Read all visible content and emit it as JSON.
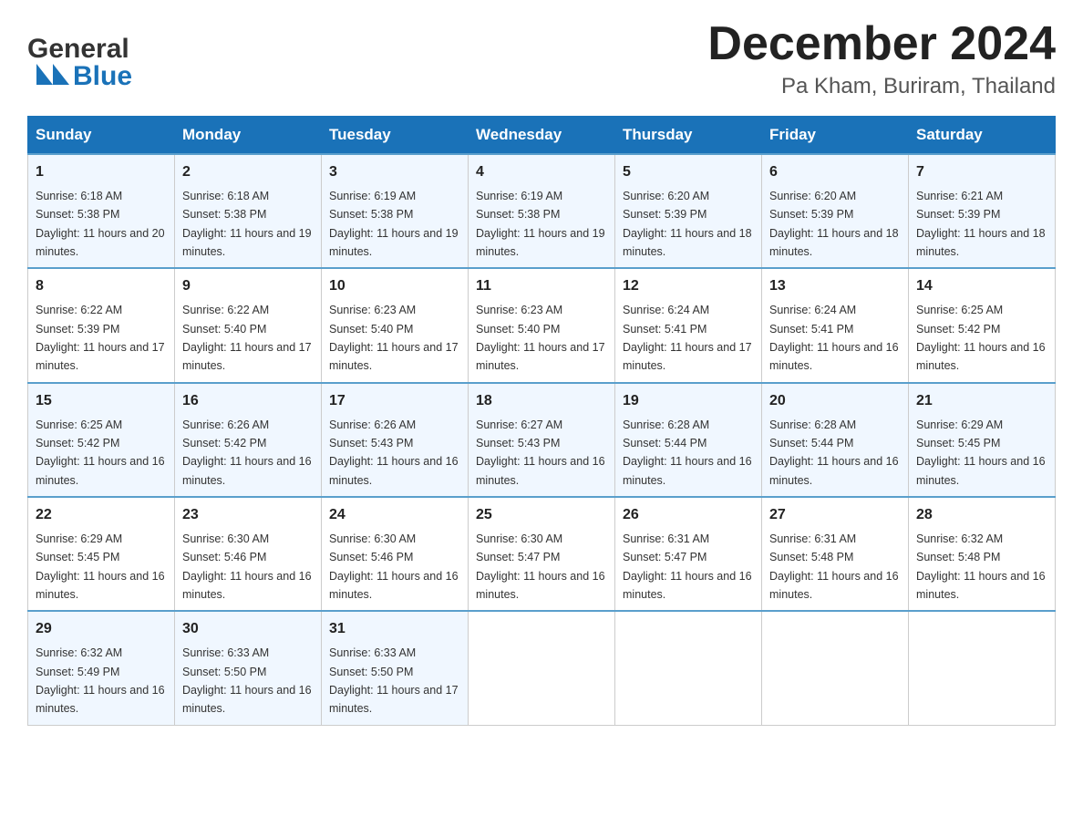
{
  "header": {
    "logo_general": "General",
    "logo_blue": "Blue",
    "title": "December 2024",
    "subtitle": "Pa Kham, Buriram, Thailand"
  },
  "days_of_week": [
    "Sunday",
    "Monday",
    "Tuesday",
    "Wednesday",
    "Thursday",
    "Friday",
    "Saturday"
  ],
  "weeks": [
    [
      {
        "day": "1",
        "sunrise": "Sunrise: 6:18 AM",
        "sunset": "Sunset: 5:38 PM",
        "daylight": "Daylight: 11 hours and 20 minutes."
      },
      {
        "day": "2",
        "sunrise": "Sunrise: 6:18 AM",
        "sunset": "Sunset: 5:38 PM",
        "daylight": "Daylight: 11 hours and 19 minutes."
      },
      {
        "day": "3",
        "sunrise": "Sunrise: 6:19 AM",
        "sunset": "Sunset: 5:38 PM",
        "daylight": "Daylight: 11 hours and 19 minutes."
      },
      {
        "day": "4",
        "sunrise": "Sunrise: 6:19 AM",
        "sunset": "Sunset: 5:38 PM",
        "daylight": "Daylight: 11 hours and 19 minutes."
      },
      {
        "day": "5",
        "sunrise": "Sunrise: 6:20 AM",
        "sunset": "Sunset: 5:39 PM",
        "daylight": "Daylight: 11 hours and 18 minutes."
      },
      {
        "day": "6",
        "sunrise": "Sunrise: 6:20 AM",
        "sunset": "Sunset: 5:39 PM",
        "daylight": "Daylight: 11 hours and 18 minutes."
      },
      {
        "day": "7",
        "sunrise": "Sunrise: 6:21 AM",
        "sunset": "Sunset: 5:39 PM",
        "daylight": "Daylight: 11 hours and 18 minutes."
      }
    ],
    [
      {
        "day": "8",
        "sunrise": "Sunrise: 6:22 AM",
        "sunset": "Sunset: 5:39 PM",
        "daylight": "Daylight: 11 hours and 17 minutes."
      },
      {
        "day": "9",
        "sunrise": "Sunrise: 6:22 AM",
        "sunset": "Sunset: 5:40 PM",
        "daylight": "Daylight: 11 hours and 17 minutes."
      },
      {
        "day": "10",
        "sunrise": "Sunrise: 6:23 AM",
        "sunset": "Sunset: 5:40 PM",
        "daylight": "Daylight: 11 hours and 17 minutes."
      },
      {
        "day": "11",
        "sunrise": "Sunrise: 6:23 AM",
        "sunset": "Sunset: 5:40 PM",
        "daylight": "Daylight: 11 hours and 17 minutes."
      },
      {
        "day": "12",
        "sunrise": "Sunrise: 6:24 AM",
        "sunset": "Sunset: 5:41 PM",
        "daylight": "Daylight: 11 hours and 17 minutes."
      },
      {
        "day": "13",
        "sunrise": "Sunrise: 6:24 AM",
        "sunset": "Sunset: 5:41 PM",
        "daylight": "Daylight: 11 hours and 16 minutes."
      },
      {
        "day": "14",
        "sunrise": "Sunrise: 6:25 AM",
        "sunset": "Sunset: 5:42 PM",
        "daylight": "Daylight: 11 hours and 16 minutes."
      }
    ],
    [
      {
        "day": "15",
        "sunrise": "Sunrise: 6:25 AM",
        "sunset": "Sunset: 5:42 PM",
        "daylight": "Daylight: 11 hours and 16 minutes."
      },
      {
        "day": "16",
        "sunrise": "Sunrise: 6:26 AM",
        "sunset": "Sunset: 5:42 PM",
        "daylight": "Daylight: 11 hours and 16 minutes."
      },
      {
        "day": "17",
        "sunrise": "Sunrise: 6:26 AM",
        "sunset": "Sunset: 5:43 PM",
        "daylight": "Daylight: 11 hours and 16 minutes."
      },
      {
        "day": "18",
        "sunrise": "Sunrise: 6:27 AM",
        "sunset": "Sunset: 5:43 PM",
        "daylight": "Daylight: 11 hours and 16 minutes."
      },
      {
        "day": "19",
        "sunrise": "Sunrise: 6:28 AM",
        "sunset": "Sunset: 5:44 PM",
        "daylight": "Daylight: 11 hours and 16 minutes."
      },
      {
        "day": "20",
        "sunrise": "Sunrise: 6:28 AM",
        "sunset": "Sunset: 5:44 PM",
        "daylight": "Daylight: 11 hours and 16 minutes."
      },
      {
        "day": "21",
        "sunrise": "Sunrise: 6:29 AM",
        "sunset": "Sunset: 5:45 PM",
        "daylight": "Daylight: 11 hours and 16 minutes."
      }
    ],
    [
      {
        "day": "22",
        "sunrise": "Sunrise: 6:29 AM",
        "sunset": "Sunset: 5:45 PM",
        "daylight": "Daylight: 11 hours and 16 minutes."
      },
      {
        "day": "23",
        "sunrise": "Sunrise: 6:30 AM",
        "sunset": "Sunset: 5:46 PM",
        "daylight": "Daylight: 11 hours and 16 minutes."
      },
      {
        "day": "24",
        "sunrise": "Sunrise: 6:30 AM",
        "sunset": "Sunset: 5:46 PM",
        "daylight": "Daylight: 11 hours and 16 minutes."
      },
      {
        "day": "25",
        "sunrise": "Sunrise: 6:30 AM",
        "sunset": "Sunset: 5:47 PM",
        "daylight": "Daylight: 11 hours and 16 minutes."
      },
      {
        "day": "26",
        "sunrise": "Sunrise: 6:31 AM",
        "sunset": "Sunset: 5:47 PM",
        "daylight": "Daylight: 11 hours and 16 minutes."
      },
      {
        "day": "27",
        "sunrise": "Sunrise: 6:31 AM",
        "sunset": "Sunset: 5:48 PM",
        "daylight": "Daylight: 11 hours and 16 minutes."
      },
      {
        "day": "28",
        "sunrise": "Sunrise: 6:32 AM",
        "sunset": "Sunset: 5:48 PM",
        "daylight": "Daylight: 11 hours and 16 minutes."
      }
    ],
    [
      {
        "day": "29",
        "sunrise": "Sunrise: 6:32 AM",
        "sunset": "Sunset: 5:49 PM",
        "daylight": "Daylight: 11 hours and 16 minutes."
      },
      {
        "day": "30",
        "sunrise": "Sunrise: 6:33 AM",
        "sunset": "Sunset: 5:50 PM",
        "daylight": "Daylight: 11 hours and 16 minutes."
      },
      {
        "day": "31",
        "sunrise": "Sunrise: 6:33 AM",
        "sunset": "Sunset: 5:50 PM",
        "daylight": "Daylight: 11 hours and 17 minutes."
      },
      null,
      null,
      null,
      null
    ]
  ],
  "colors": {
    "header_bg": "#1a72b8",
    "header_text": "#ffffff",
    "border": "#5a9fcc",
    "row_odd": "#f0f7ff",
    "row_even": "#ffffff"
  }
}
